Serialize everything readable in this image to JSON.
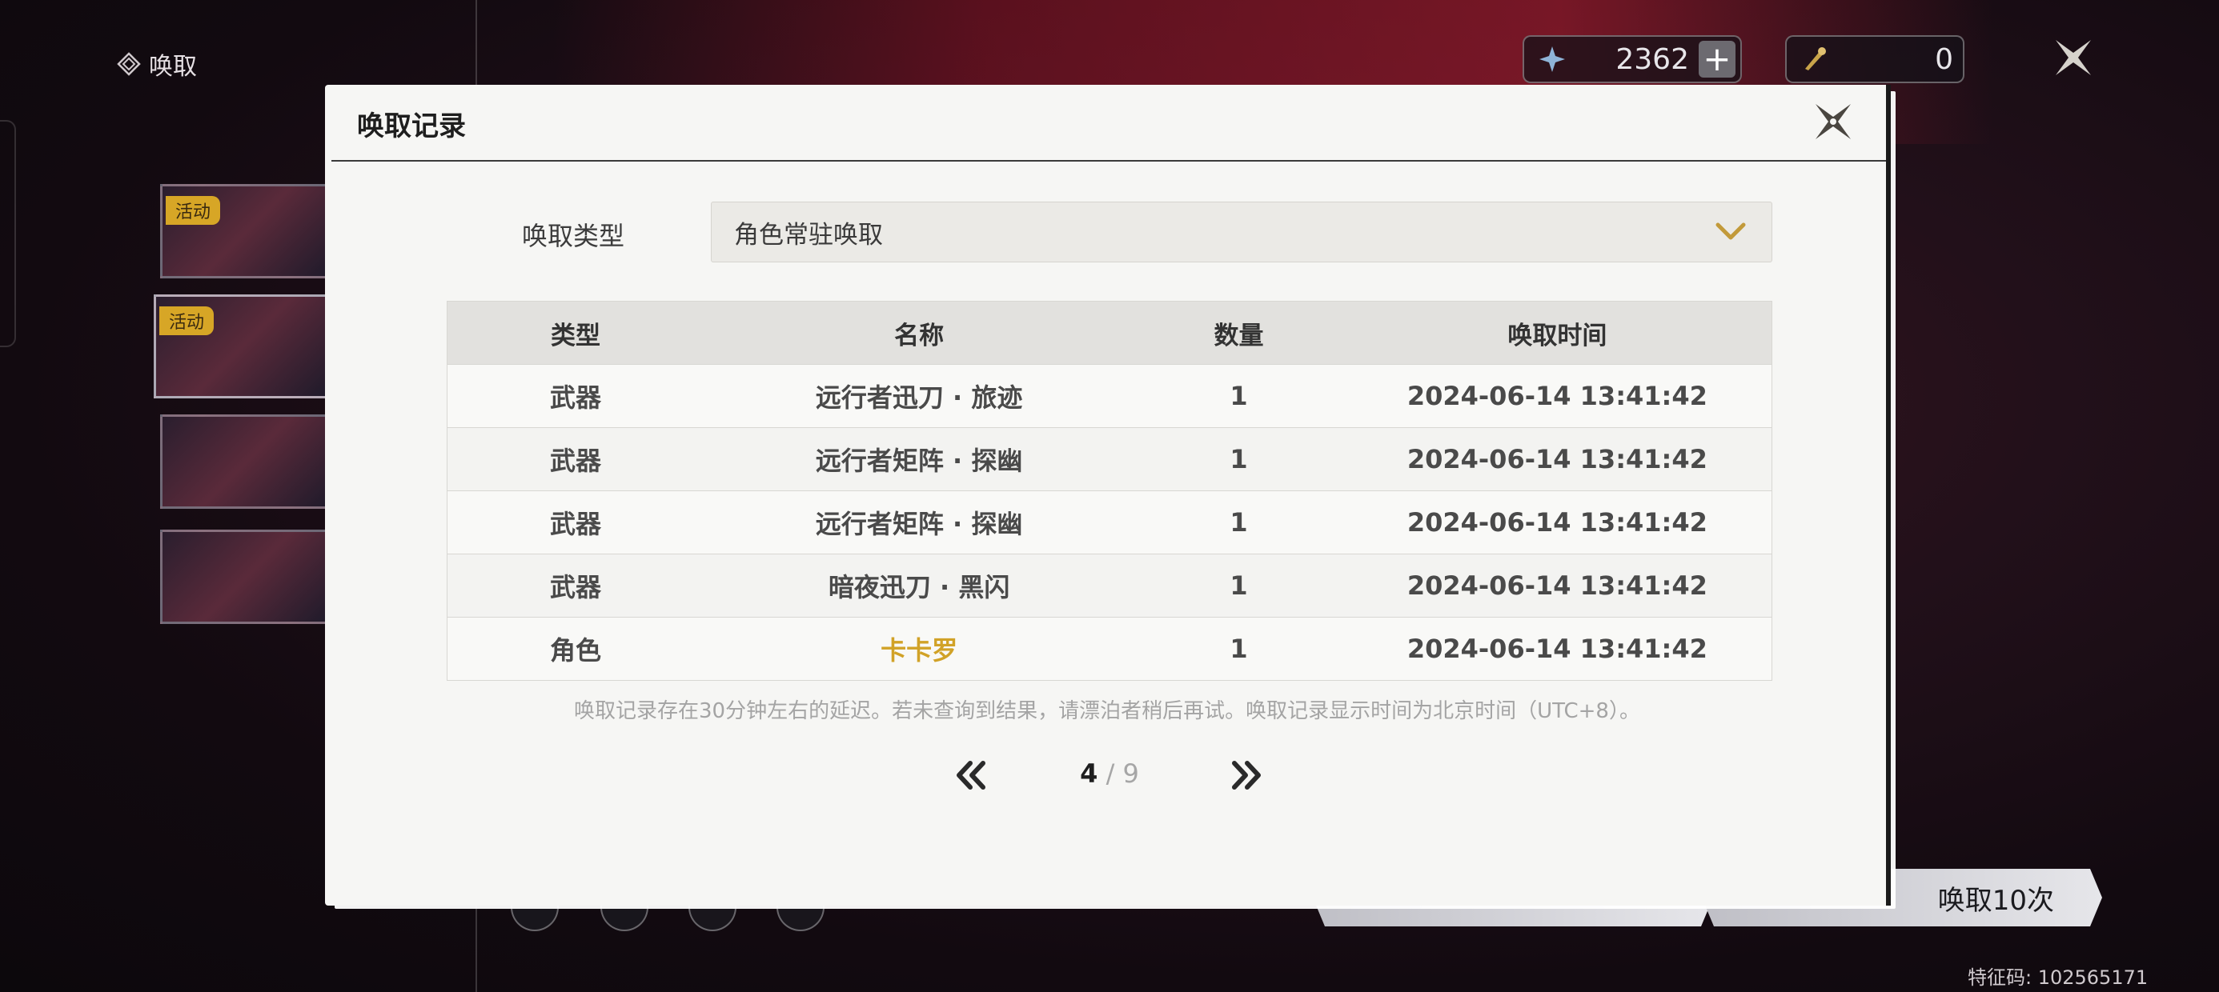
{
  "top_bar": {
    "title": "唤取",
    "currency1": {
      "value": "2362",
      "plus": "+"
    },
    "currency2": {
      "value": "0"
    }
  },
  "banners": [
    {
      "badge": "活动"
    },
    {
      "badge": "活动"
    },
    {
      "badge": ""
    },
    {
      "badge": ""
    }
  ],
  "bottom": {
    "pull10_label": "唤取10次",
    "device_id": "特征码: 102565171"
  },
  "modal": {
    "title": "唤取记录",
    "type_label": "唤取类型",
    "type_value": "角色常驻唤取",
    "columns": [
      "类型",
      "名称",
      "数量",
      "唤取时间"
    ],
    "rows": [
      {
        "type": "武器",
        "name": "远行者迅刀 · 旅迹",
        "qty": "1",
        "time": "2024-06-14 13:41:42"
      },
      {
        "type": "武器",
        "name": "远行者矩阵 · 探幽",
        "qty": "1",
        "time": "2024-06-14 13:41:42"
      },
      {
        "type": "武器",
        "name": "远行者矩阵 · 探幽",
        "qty": "1",
        "time": "2024-06-14 13:41:42"
      },
      {
        "type": "武器",
        "name": "暗夜迅刀 · 黑闪",
        "qty": "1",
        "time": "2024-06-14 13:41:42"
      },
      {
        "type": "角色",
        "name": "卡卡罗",
        "qty": "1",
        "time": "2024-06-14 13:41:42"
      }
    ],
    "notice": "唤取记录存在30分钟左右的延迟。若未查询到结果，请漂泊者稍后再试。唤取记录显示时间为北京时间（UTC+8）。",
    "pager": {
      "current": "4",
      "separator": " / ",
      "total": "9"
    }
  },
  "colors": {
    "gold": "#d1a227",
    "badge": "#d7a626"
  }
}
